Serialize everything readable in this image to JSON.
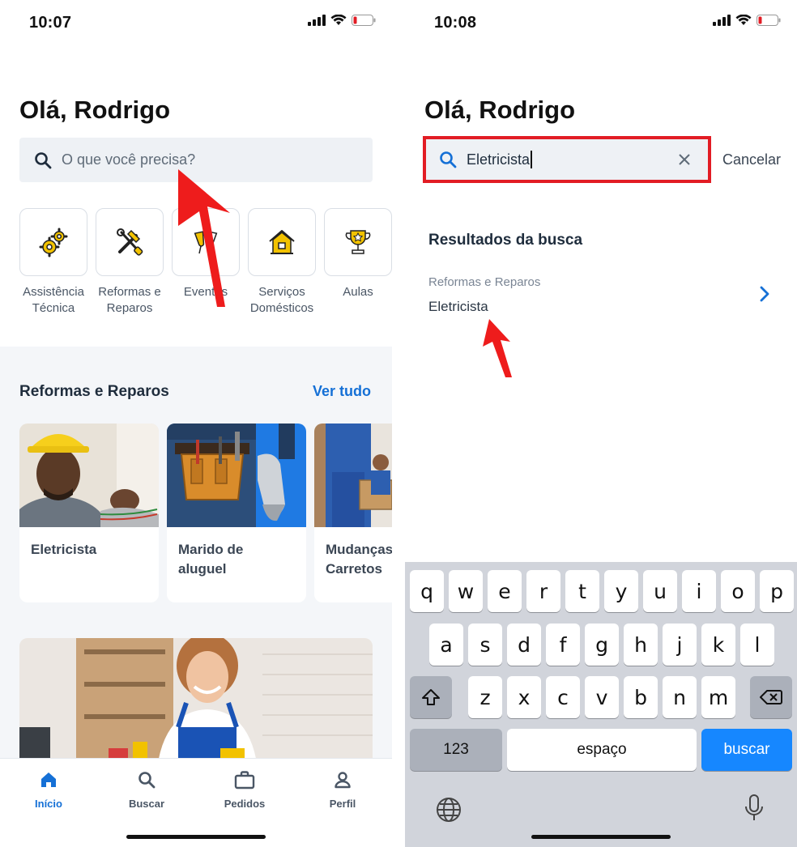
{
  "left": {
    "status": {
      "time": "10:07"
    },
    "greeting": "Olá, Rodrigo",
    "search": {
      "placeholder": "O que você precisa?"
    },
    "categories": [
      {
        "label": "Assistência Técnica",
        "icon": "gears-icon"
      },
      {
        "label": "Reformas e Reparos",
        "icon": "tools-icon"
      },
      {
        "label": "Eventos",
        "icon": "champagne-glasses-icon"
      },
      {
        "label": "Serviços Domésticos",
        "icon": "house-icon"
      },
      {
        "label": "Aulas",
        "icon": "trophy-icon"
      }
    ],
    "section": {
      "title": "Reformas e Reparos",
      "link": "Ver tudo"
    },
    "cards": [
      {
        "label": "Eletricista"
      },
      {
        "label": "Marido de aluguel"
      },
      {
        "label": "Mudanças e Carretos"
      }
    ],
    "tabs": [
      {
        "label": "Início",
        "icon": "home-icon",
        "active": true
      },
      {
        "label": "Buscar",
        "icon": "search-icon",
        "active": false
      },
      {
        "label": "Pedidos",
        "icon": "briefcase-icon",
        "active": false
      },
      {
        "label": "Perfil",
        "icon": "user-icon",
        "active": false
      }
    ]
  },
  "right": {
    "status": {
      "time": "10:08"
    },
    "greeting": "Olá, Rodrigo",
    "search": {
      "value": "Eletricista",
      "cancel": "Cancelar"
    },
    "results": {
      "title": "Resultados da busca",
      "items": [
        {
          "category": "Reformas e Reparos",
          "name": "Eletricista"
        }
      ]
    },
    "keyboard": {
      "row1": [
        "q",
        "w",
        "e",
        "r",
        "t",
        "y",
        "u",
        "i",
        "o",
        "p"
      ],
      "row2": [
        "a",
        "s",
        "d",
        "f",
        "g",
        "h",
        "j",
        "k",
        "l"
      ],
      "row3": [
        "z",
        "x",
        "c",
        "v",
        "b",
        "n",
        "m"
      ],
      "numbers": "123",
      "space": "espaço",
      "go": "buscar"
    }
  },
  "colors": {
    "accent": "#1570d6",
    "highlight_red": "#e21c24",
    "icon_yellow": "#f2c200",
    "keyboard_blue": "#1687ff"
  }
}
